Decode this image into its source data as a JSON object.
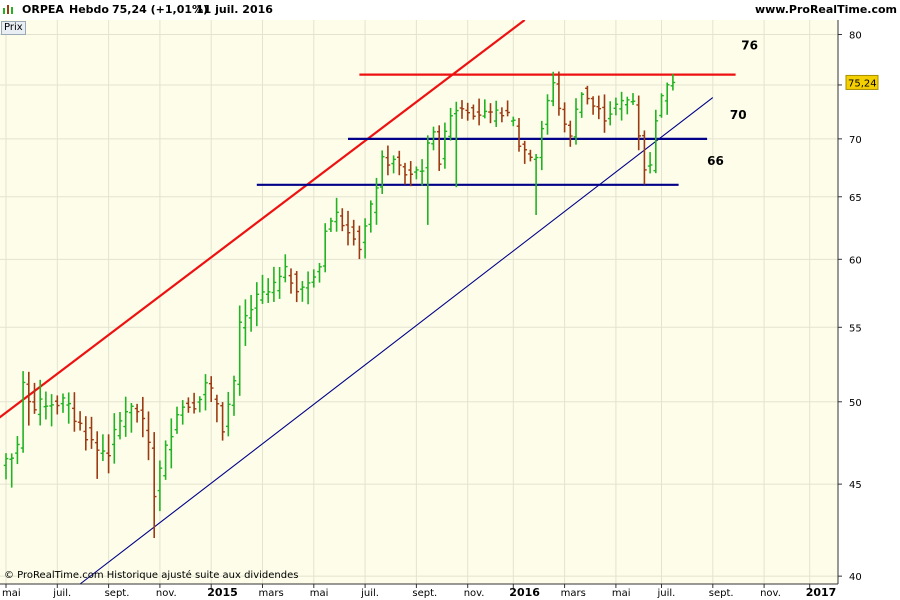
{
  "header": {
    "ticker": "ORPEA",
    "period": "Hebdo",
    "price_change": "75,24 (+1,01%)",
    "date": "11 juil. 2016",
    "site": "www.ProRealTime.com"
  },
  "panel_label": "Prix",
  "footer_text": "© ProRealTime.com Historique ajusté suite aux dividendes",
  "colors": {
    "up": "#21b321",
    "down": "#9c3a12",
    "red_line": "#ee1111",
    "blue_line": "#000088",
    "bg": "#fdfdea"
  },
  "chart_data": {
    "type": "ohlc",
    "y_scale": "log",
    "ylim": [
      39.6,
      81.5
    ],
    "y_ticks": [
      40,
      45,
      50,
      55,
      60,
      65,
      70,
      75,
      80
    ],
    "x_ticks": [
      {
        "label": "mai",
        "i": 0,
        "bold": false
      },
      {
        "label": "juil.",
        "i": 9,
        "bold": false
      },
      {
        "label": "sept.",
        "i": 18,
        "bold": false
      },
      {
        "label": "nov.",
        "i": 27,
        "bold": false
      },
      {
        "label": "2015",
        "i": 36,
        "bold": true
      },
      {
        "label": "mars",
        "i": 45,
        "bold": false
      },
      {
        "label": "mai",
        "i": 54,
        "bold": false
      },
      {
        "label": "juil.",
        "i": 63,
        "bold": false
      },
      {
        "label": "sept.",
        "i": 72,
        "bold": false
      },
      {
        "label": "nov.",
        "i": 81,
        "bold": false
      },
      {
        "label": "2016",
        "i": 89,
        "bold": true
      },
      {
        "label": "mars",
        "i": 98,
        "bold": false
      },
      {
        "label": "mai",
        "i": 107,
        "bold": false
      },
      {
        "label": "juil.",
        "i": 115,
        "bold": false
      },
      {
        "label": "sept.",
        "i": 124,
        "bold": false
      },
      {
        "label": "nov.",
        "i": 133,
        "bold": false
      },
      {
        "label": "2017",
        "i": 141,
        "bold": true
      }
    ],
    "last_price": "75,24",
    "annotations": [
      {
        "label": "76",
        "value": 78.5,
        "i": 129
      },
      {
        "label": "70",
        "value": 71.8,
        "i": 127
      },
      {
        "label": "66",
        "value": 67.7,
        "i": 123
      }
    ],
    "horizontal_levels": [
      {
        "value": 76,
        "i_start": 62,
        "i_end": 128,
        "color": "red"
      },
      {
        "value": 70,
        "i_start": 60,
        "i_end": 123,
        "color": "blue"
      },
      {
        "value": 66,
        "i_start": 44,
        "i_end": 118,
        "color": "blue"
      }
    ],
    "trend_lines": [
      {
        "color": "red",
        "from": {
          "i": -3,
          "value": 48.5
        },
        "to": {
          "i": 91,
          "value": 81.5
        }
      },
      {
        "color": "blue",
        "from": {
          "i": 13,
          "value": 39.6
        },
        "to": {
          "i": 124,
          "value": 73.8
        }
      }
    ],
    "waypoints": [
      [
        0,
        46.5
      ],
      [
        2,
        47.0
      ],
      [
        3,
        51.0
      ],
      [
        5,
        49.5
      ],
      [
        7,
        50.0
      ],
      [
        10,
        50.0
      ],
      [
        13,
        48.5
      ],
      [
        16,
        47.0
      ],
      [
        18,
        47.0
      ],
      [
        21,
        49.5
      ],
      [
        23,
        49.5
      ],
      [
        25,
        47.5
      ],
      [
        26,
        44.5
      ],
      [
        28,
        47.0
      ],
      [
        30,
        49.5
      ],
      [
        33,
        50.0
      ],
      [
        35,
        51.0
      ],
      [
        37,
        50.0
      ],
      [
        38,
        48.5
      ],
      [
        40,
        51.0
      ],
      [
        41,
        55.0
      ],
      [
        44,
        57.0
      ],
      [
        46,
        57.5
      ],
      [
        49,
        59.0
      ],
      [
        51,
        58.0
      ],
      [
        53,
        58.0
      ],
      [
        55,
        59.5
      ],
      [
        56,
        62.5
      ],
      [
        58,
        63.5
      ],
      [
        61,
        62.0
      ],
      [
        62,
        61.0
      ],
      [
        64,
        64.0
      ],
      [
        66,
        68.0
      ],
      [
        68,
        68.0
      ],
      [
        70,
        67.0
      ],
      [
        71,
        67.0
      ],
      [
        73,
        67.5
      ],
      [
        75,
        71.0
      ],
      [
        76,
        68.0
      ],
      [
        78,
        72.5
      ],
      [
        80,
        73.0
      ],
      [
        82,
        72.5
      ],
      [
        85,
        72.0
      ],
      [
        87,
        72.5
      ],
      [
        89,
        71.5
      ],
      [
        90,
        69.5
      ],
      [
        92,
        68.5
      ],
      [
        93,
        68.5
      ],
      [
        95,
        73.5
      ],
      [
        96,
        75.0
      ],
      [
        98,
        71.0
      ],
      [
        99,
        70.5
      ],
      [
        101,
        74.5
      ],
      [
        103,
        73.0
      ],
      [
        105,
        72.0
      ],
      [
        107,
        73.0
      ],
      [
        109,
        73.5
      ],
      [
        110,
        73.5
      ],
      [
        111,
        70.5
      ],
      [
        112,
        67.5
      ],
      [
        113,
        67.5
      ],
      [
        114,
        72.0
      ],
      [
        116,
        75.3
      ],
      [
        117,
        75.24
      ]
    ],
    "extremes": [
      [
        1,
        44.8,
        46.5
      ],
      [
        4,
        48.5,
        51.5
      ],
      [
        16,
        45.3,
        46.5
      ],
      [
        26,
        42.0,
        44.0
      ],
      [
        74,
        62.7,
        64.0
      ],
      [
        79,
        65.8,
        67.0
      ],
      [
        93,
        63.5,
        66.0
      ],
      [
        97,
        74.5,
        76.3
      ],
      [
        112,
        66.3,
        67.5
      ],
      [
        117,
        74.8,
        75.5
      ]
    ]
  }
}
